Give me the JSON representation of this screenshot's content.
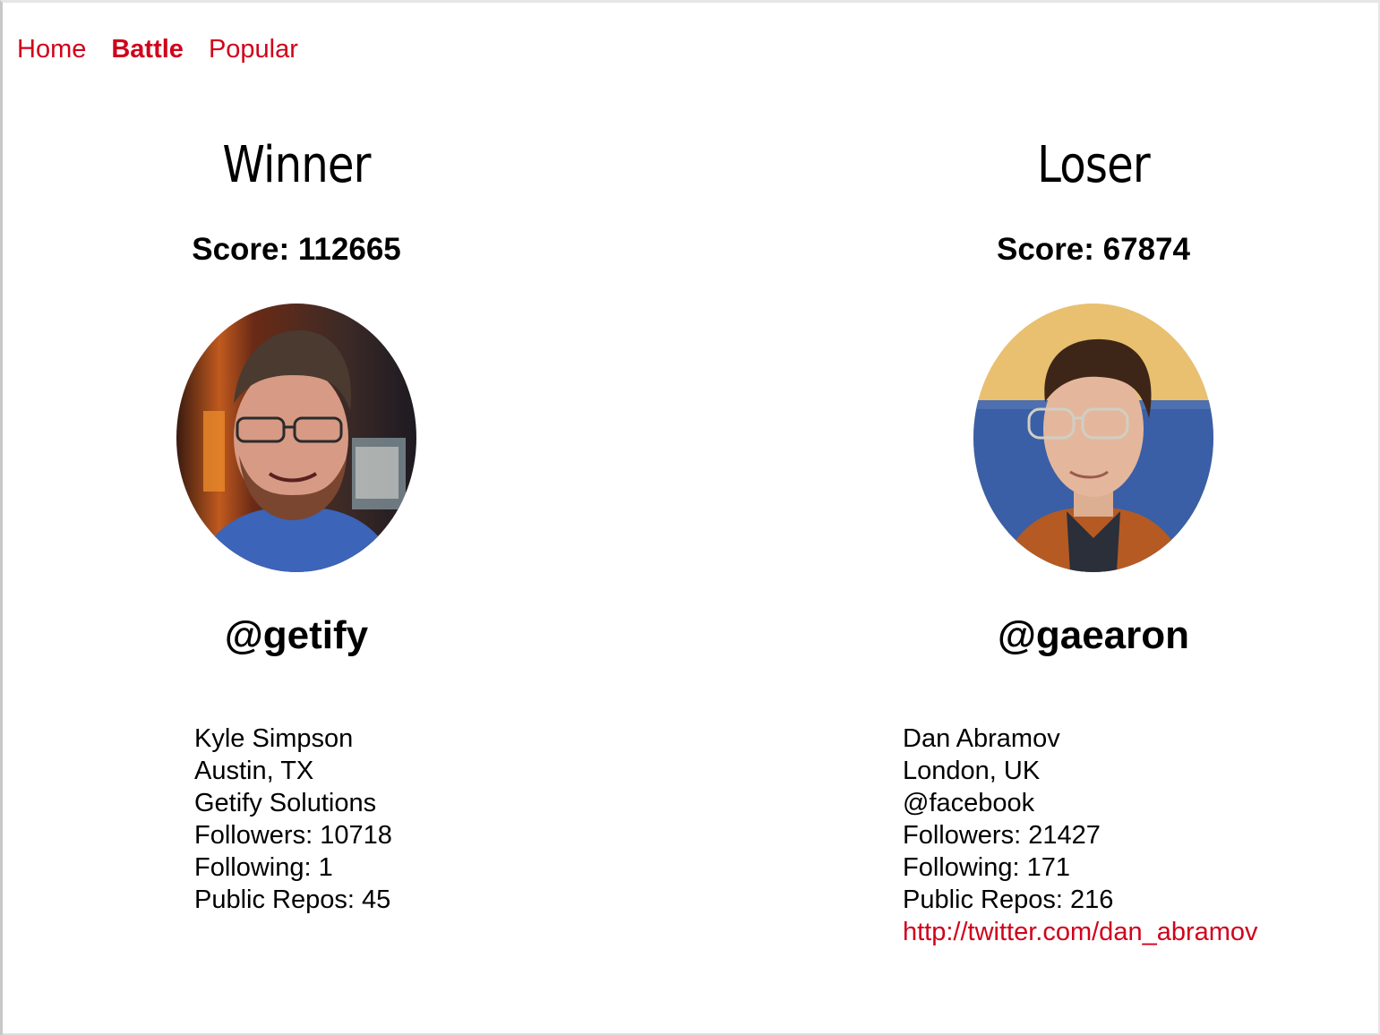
{
  "nav": {
    "items": [
      {
        "label": "Home",
        "active": false
      },
      {
        "label": "Battle",
        "active": true
      },
      {
        "label": "Popular",
        "active": false
      }
    ],
    "accent_color": "#d0021b"
  },
  "winner": {
    "heading": "Winner",
    "score": "Score: 112665",
    "username": "@getify",
    "details": {
      "name": "Kyle Simpson",
      "location": "Austin, TX",
      "company": "Getify Solutions",
      "followers": "Followers: 10718",
      "following": "Following: 1",
      "repos": "Public Repos: 45"
    }
  },
  "loser": {
    "heading": "Loser",
    "score": "Score: 67874",
    "username": "@gaearon",
    "details": {
      "name": "Dan Abramov",
      "location": "London, UK",
      "company": "@facebook",
      "followers": "Followers: 21427",
      "following": "Following: 171",
      "repos": "Public Repos: 216",
      "blog": "http://twitter.com/dan_abramov"
    }
  }
}
